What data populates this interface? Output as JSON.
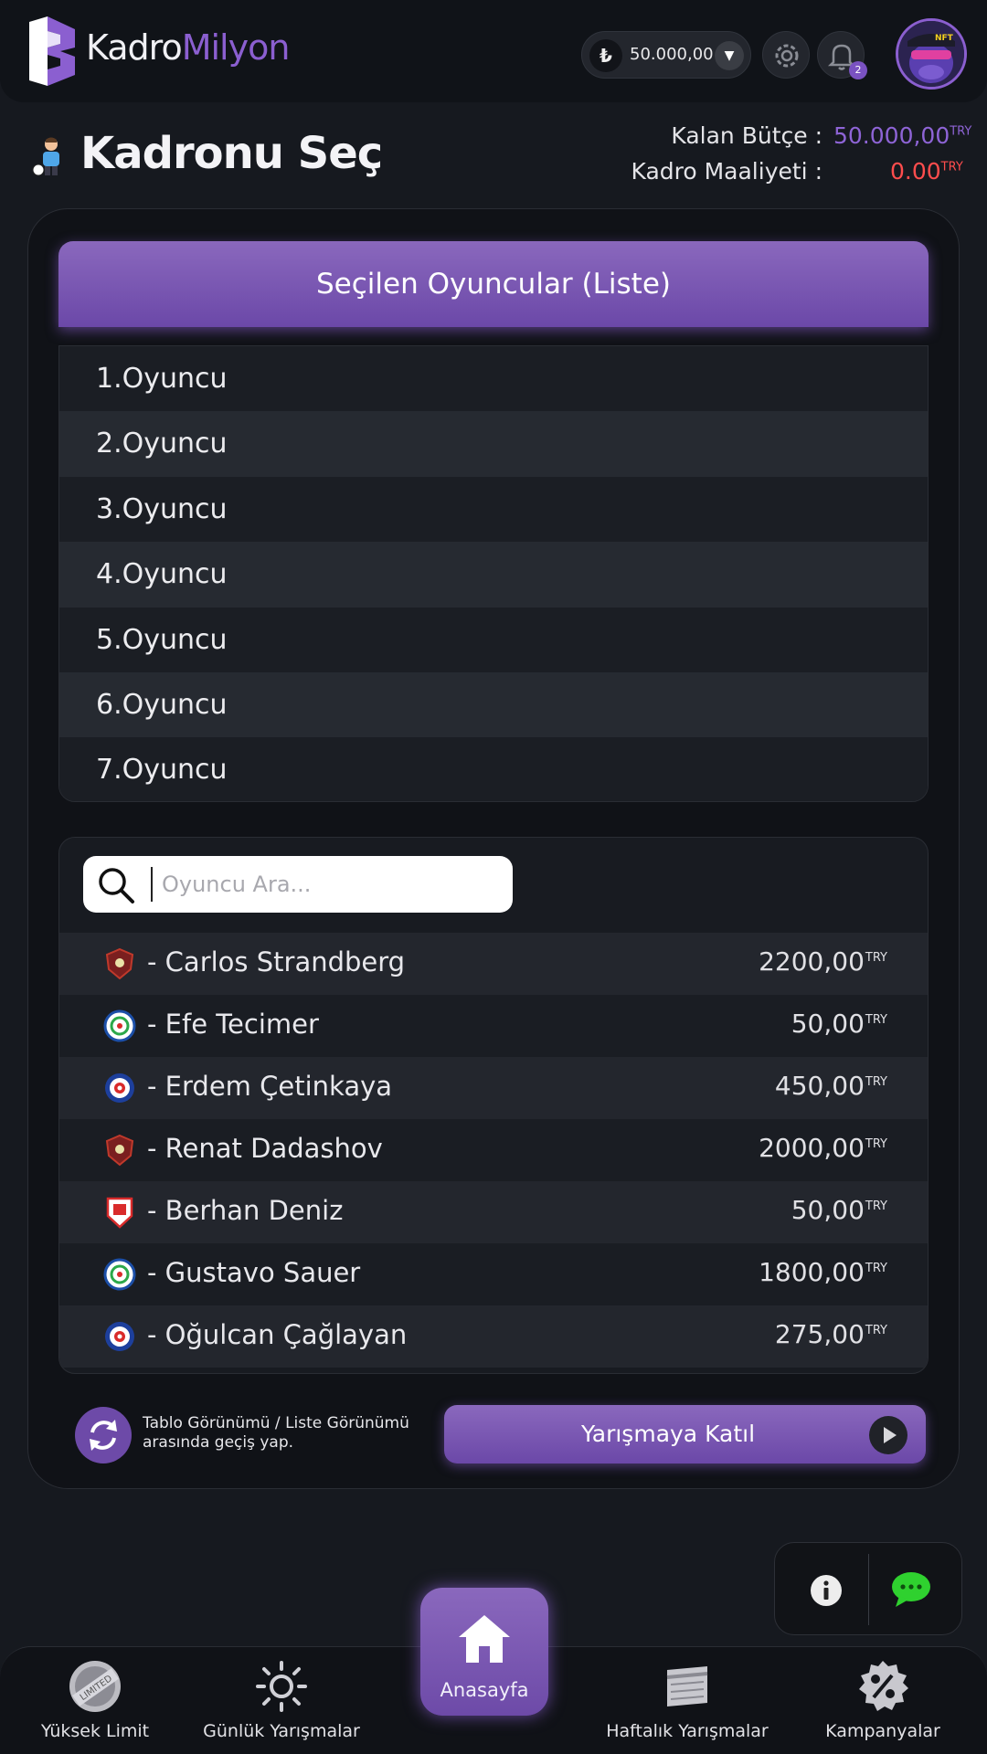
{
  "header": {
    "logo_part1": "Kadro",
    "logo_part2": "Milyon",
    "currency_symbol": "₺",
    "balance": "50.000,00",
    "notification_count": "2",
    "avatar_caption": "NFT"
  },
  "page": {
    "title": "Kadronu Seç",
    "budget_label": "Kalan Bütçe :",
    "budget_value": "50.000,00",
    "cost_label": "Kadro Maaliyeti :",
    "cost_value": "0.00",
    "currency_unit": "TRY"
  },
  "selected": {
    "header": "Seçilen Oyuncular (Liste)",
    "slots": [
      "1.Oyuncu",
      "2.Oyuncu",
      "3.Oyuncu",
      "4.Oyuncu",
      "5.Oyuncu",
      "6.Oyuncu",
      "7.Oyuncu"
    ]
  },
  "search": {
    "placeholder": "Oyuncu Ara..."
  },
  "players": [
    {
      "name": "- Carlos Strandberg",
      "price": "2200,00",
      "club": "hatayspor"
    },
    {
      "name": "- Efe Tecimer",
      "price": "50,00",
      "club": "rizespor"
    },
    {
      "name": "- Erdem Çetinkaya",
      "price": "450,00",
      "club": "kasimpasa"
    },
    {
      "name": "- Renat Dadashov",
      "price": "2000,00",
      "club": "hatayspor"
    },
    {
      "name": "- Berhan Deniz",
      "price": "50,00",
      "club": "samsunspor"
    },
    {
      "name": "- Gustavo Sauer",
      "price": "1800,00",
      "club": "rizespor"
    },
    {
      "name": "- Oğulcan Çağlayan",
      "price": "275,00",
      "club": "kasimpasa"
    }
  ],
  "actions": {
    "toggle_text": "Tablo Görünümü / Liste Görünümü arasında geçiş yap.",
    "join_label": "Yarışmaya Katıl"
  },
  "nav": {
    "item1": "Yüksek Limit",
    "item2": "Günlük Yarışmalar",
    "home": "Anasayfa",
    "item4": "Haftalık Yarışmalar",
    "item5": "Kampanyalar",
    "limited_badge_text": "LIMITED"
  },
  "colors": {
    "accent": "#8b5fd0",
    "cost_red": "#ff4d4d",
    "chat_green": "#2fd12f"
  }
}
